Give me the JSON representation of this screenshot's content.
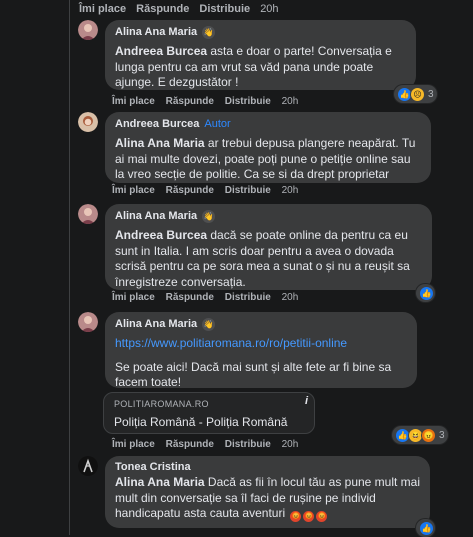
{
  "top_actions": {
    "like": "Îmi place",
    "reply": "Răspunde",
    "share": "Distribuie",
    "time": "20h"
  },
  "comments": [
    {
      "name": "Alina Ana Maria",
      "mention": "Andreea Burcea",
      "text": " asta e doar o parte! Conversația e lunga pentru ca am vrut sa văd pana unde poate ajunge. E dezgustător !",
      "actions": {
        "like": "Îmi place",
        "reply": "Răspunde",
        "share": "Distribuie",
        "time": "20h"
      },
      "reactions": {
        "icons": [
          "like-icon",
          "sad-icon"
        ],
        "count": "3"
      }
    },
    {
      "name": "Andreea Burcea",
      "badge": "Autor",
      "mention": "Alina Ana Maria",
      "text": " ar trebui depusa plangere neapărat. Tu ai mai multe dovezi, poate poți pune o petiție online sau la vreo secție de politie. Ca se si da drept proprietar",
      "actions": {
        "like": "Îmi place",
        "reply": "Răspunde",
        "share": "Distribuie",
        "time": "20h"
      }
    },
    {
      "name": "Alina Ana Maria",
      "mention": "Andreea Burcea",
      "text": " dacă se poate online da pentru ca eu sunt in Italia. I am scris doar pentru a avea o dovada scrisă pentru ca pe sora mea a sunat o și nu a reușit sa înregistreze conversația.",
      "actions": {
        "like": "Îmi place",
        "reply": "Răspunde",
        "share": "Distribuie",
        "time": "20h"
      },
      "reactions": {
        "icons": [
          "like-icon"
        ]
      }
    },
    {
      "name": "Alina Ana Maria",
      "link": "https://www.politiaromana.ro/ro/petitii-online",
      "text": "Se poate aici! Dacă mai sunt și alte fete ar fi bine sa facem toate!",
      "preview": {
        "domain": "POLITIAROMANA.RO",
        "title": "Poliția Română - Poliția Română",
        "info": "i"
      },
      "actions": {
        "like": "Îmi place",
        "reply": "Răspunde",
        "share": "Distribuie",
        "time": "20h"
      },
      "reactions": {
        "icons": [
          "like-icon",
          "haha-icon",
          "angry-icon"
        ],
        "count": "3"
      }
    },
    {
      "name": "Tonea Cristina",
      "mention": "Alina Ana Maria",
      "text": " Dacă as fii în locul tău as pune mult mai mult din conversație sa îl faci de rușine pe individ handicapatu asta cauta aventuri",
      "emojis": [
        "angry-emoji",
        "angry-emoji",
        "angry-emoji"
      ],
      "reactions": {
        "icons": [
          "like-icon"
        ]
      }
    }
  ]
}
